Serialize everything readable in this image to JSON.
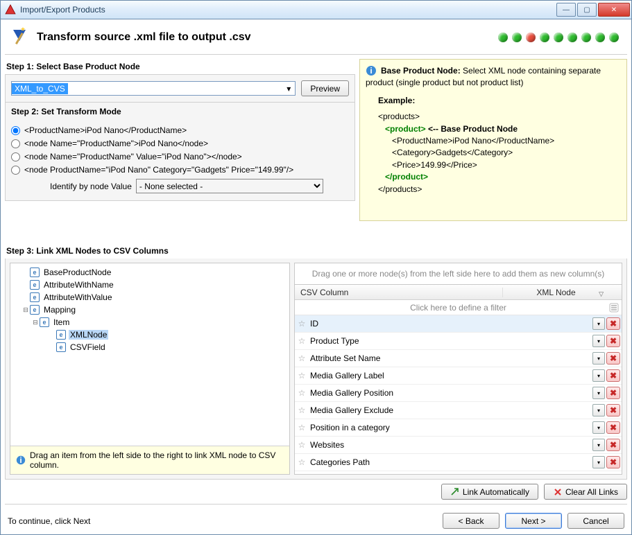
{
  "window": {
    "title": "Import/Export Products"
  },
  "wizard": {
    "title": "Transform source .xml file to output .csv",
    "dots": [
      "green",
      "green",
      "red",
      "green",
      "green",
      "green",
      "green",
      "green",
      "green"
    ]
  },
  "step1": {
    "label": "Step 1: Select Base Product Node",
    "combo_value": "XML_to_CVS",
    "preview_btn": "Preview"
  },
  "step2": {
    "label": "Step 2: Set Transform Mode",
    "options": [
      "<ProductName>iPod Nano</ProductName>",
      "<node Name=\"ProductName\">iPod Nano</node>",
      "<node Name=\"ProductName\" Value=\"iPod Nano\"></node>",
      "<node ProductName=\"iPod Nano\" Category=\"Gadgets\" Price=\"149.99\"/>"
    ],
    "selected_index": 0,
    "identify_label": "Identify by node Value",
    "identify_selected": "- None selected -"
  },
  "help": {
    "title": "Base Product Node:",
    "text": "Select XML node containing separate product (single product but not product list)",
    "example_label": "Example:",
    "lines": {
      "l1": "<products>",
      "l2a": "   <product>",
      "l2b": " <-- Base Product Node",
      "l3": "      <ProductName>iPod Nano</ProductName>",
      "l4": "      <Category>Gadgets</Category>",
      "l5": "      <Price>149.99</Price>",
      "l6": "   </product>",
      "l7": "</products>"
    }
  },
  "step3": {
    "label": "Step 3: Link XML Nodes to CSV Columns",
    "tree": [
      {
        "level": 1,
        "label": "BaseProductNode"
      },
      {
        "level": 1,
        "label": "AttributeWithName"
      },
      {
        "level": 1,
        "label": "AttributeWithValue"
      },
      {
        "level": 1,
        "label": "Mapping",
        "expandable": true,
        "expanded": true
      },
      {
        "level": 2,
        "label": "Item",
        "expandable": true,
        "expanded": true
      },
      {
        "level": 3,
        "label": "XMLNode",
        "selected": true
      },
      {
        "level": 3,
        "label": "CSVField"
      }
    ],
    "tree_hint": "Drag an item from the left side to the right to link XML node to CSV column.",
    "drop_hint": "Drag one or more node(s) from the left side here to add them as new column(s)",
    "grid_head_csv": "CSV Column",
    "grid_head_xml": "XML Node",
    "filter_text": "Click here to define a filter",
    "rows": [
      {
        "name": "ID",
        "selected": true
      },
      {
        "name": "Product Type"
      },
      {
        "name": "Attribute Set Name"
      },
      {
        "name": "Media Gallery Label"
      },
      {
        "name": "Media Gallery Position"
      },
      {
        "name": "Media Gallery Exclude"
      },
      {
        "name": "Position in a category"
      },
      {
        "name": "Websites"
      },
      {
        "name": "Categories Path"
      }
    ],
    "link_auto_btn": "Link Automatically",
    "clear_links_btn": "Clear All Links"
  },
  "footer": {
    "hint": "To continue, click Next",
    "back": "< Back",
    "next": "Next >",
    "cancel": "Cancel"
  }
}
